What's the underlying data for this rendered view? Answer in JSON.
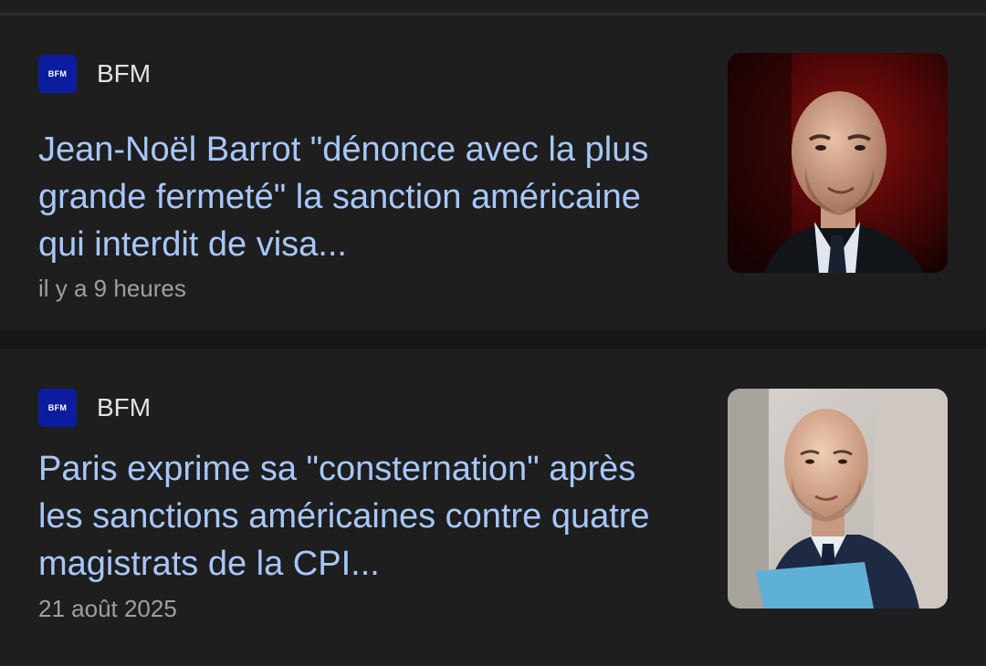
{
  "articles": [
    {
      "source": "BFM",
      "logo_text": "BFM",
      "headline": "Jean-Noël Barrot \"dénonce avec la plus grande fermeté\" la sanction américaine qui interdit de visa...",
      "time": "il y a 9 heures",
      "thumbnail_icon": "portrait-photo-red-background"
    },
    {
      "source": "BFM",
      "logo_text": "BFM",
      "headline": "Paris exprime sa \"consternation\" après les sanctions américaines contre quatre magistrats de la CPI...",
      "time": "21 août 2025",
      "thumbnail_icon": "portrait-photo-light-background"
    }
  ],
  "colors": {
    "background": "#1e1e1f",
    "headline": "#a8c7fa",
    "meta": "#9aa0a6",
    "source": "#e3e3e3",
    "logo_bg": "#0b1d9e"
  }
}
